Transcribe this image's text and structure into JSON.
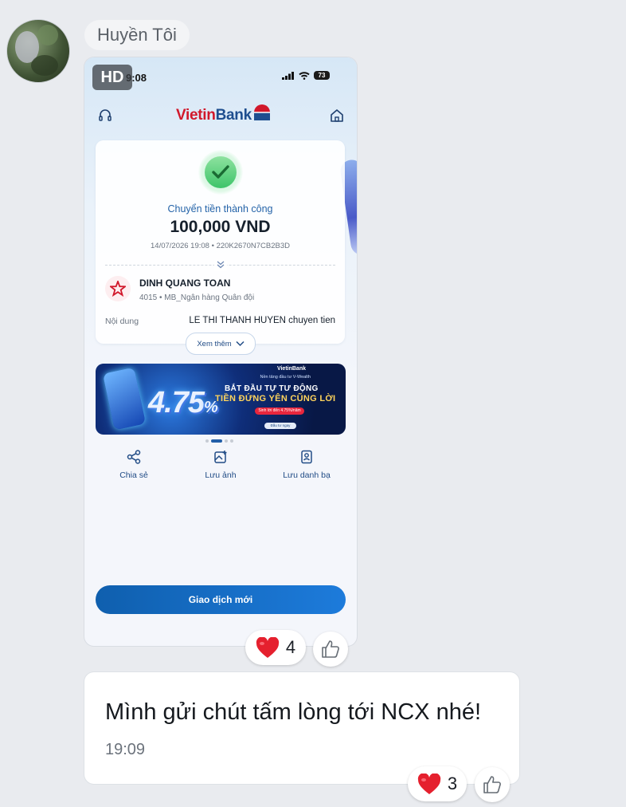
{
  "sender": {
    "name": "Huyền Tôi"
  },
  "photo": {
    "hd_badge": "HD",
    "status_bar": {
      "time": "9:08",
      "battery": "73"
    },
    "logo": {
      "text_a": "Vietin",
      "text_b": "Bank"
    },
    "receipt": {
      "status": "Chuyển tiền thành công",
      "amount": "100,000 VND",
      "meta": "14/07/2026 19:08 • 220K2670N7CB2B3D",
      "recipient_name": "DINH QUANG TOAN",
      "recipient_account": "4015 • MB_Ngân hàng Quân đội",
      "content_label": "Nội dung",
      "content_value": "LE THI THANH HUYEN chuyen tien",
      "more_label": "Xem thêm"
    },
    "banner": {
      "brand": "VietinBank",
      "subtitle": "Nền tảng đầu tư V-Wealth",
      "line1": "BẮT ĐẦU TỰ TƯ ĐỘNG",
      "line2": "TIỀN ĐỨNG YÊN CŨNG LỜI",
      "rate": "4.75",
      "percent": "%",
      "pill": "Sinh lời đến 4.75%/năm",
      "pill2": "Đầu tư ngay"
    },
    "actions": [
      {
        "label": "Chia sẻ",
        "icon": "share-icon"
      },
      {
        "label": "Lưu ảnh",
        "icon": "save-image-icon"
      },
      {
        "label": "Lưu danh bạ",
        "icon": "contact-book-icon"
      }
    ],
    "cta_label": "Giao dịch mới"
  },
  "photo_reactions": {
    "emoji": "heart",
    "count": "4"
  },
  "message": {
    "text": "Mình gửi chút tấm lòng tới NCX nhé!",
    "time": "19:09"
  },
  "message_reactions": {
    "emoji": "heart",
    "count": "3"
  },
  "colors": {
    "primary": "#215ea8",
    "success": "#3ec46a",
    "heart": "#e5202e"
  }
}
